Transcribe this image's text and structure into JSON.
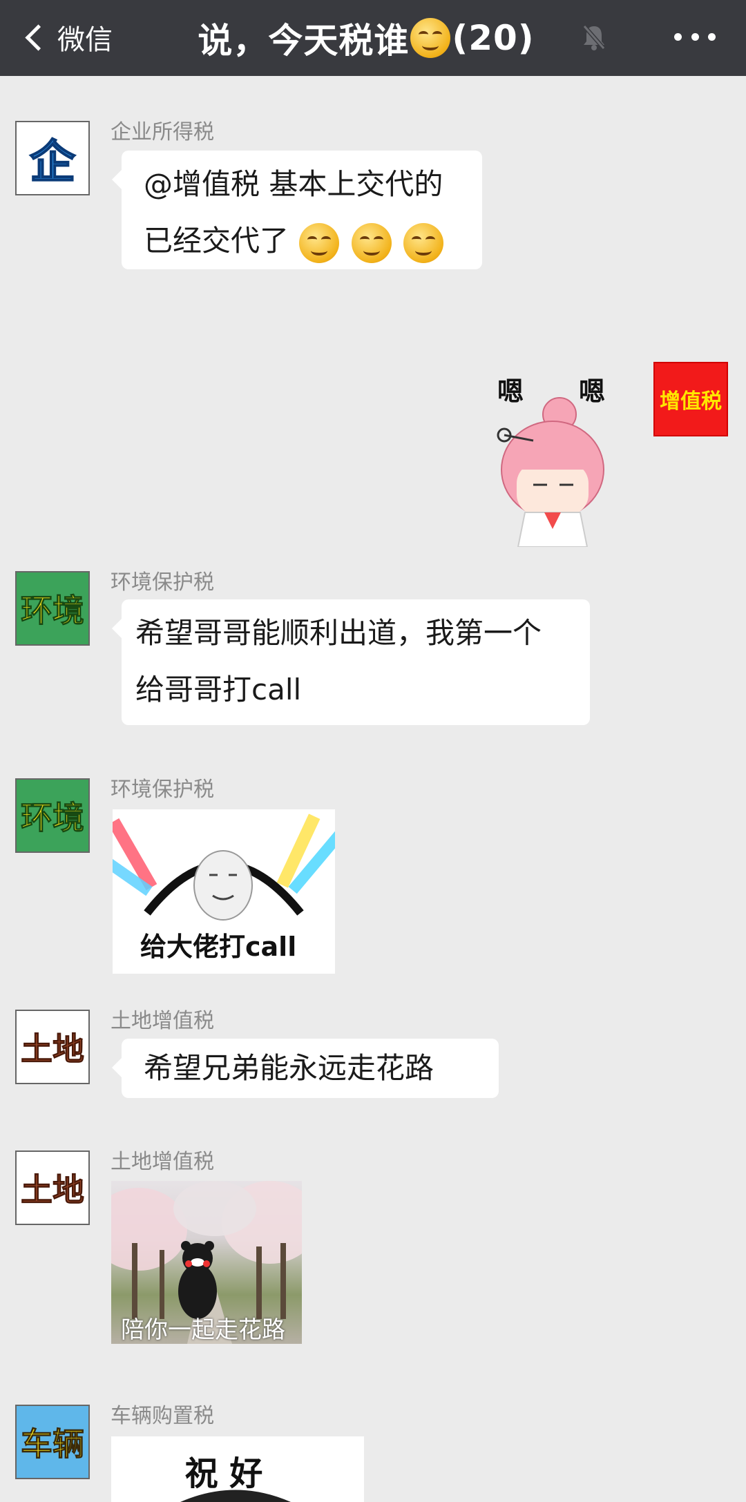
{
  "header": {
    "back_label": "微信",
    "title_pre": "说，今天税谁",
    "title_count": "(20)"
  },
  "messages": [
    {
      "sender": "企业所得税",
      "avatar_text": "企",
      "lines": [
        "@增值税 基本上交代的",
        "已经交代了"
      ]
    },
    {
      "self_avatar_text": "增值税",
      "sticker_text": "嗯 嗯"
    },
    {
      "sender": "环境保护税",
      "avatar_text": "环境",
      "lines": [
        "希望哥哥能顺利出道，我第一个",
        "给哥哥打call"
      ]
    },
    {
      "sender": "环境保护税",
      "avatar_text": "环境",
      "sticker_caption": "给大佬打call"
    },
    {
      "sender": "土地增值税",
      "avatar_text": "土地",
      "lines": [
        "希望兄弟能永远走花路"
      ]
    },
    {
      "sender": "土地增值税",
      "avatar_text": "土地",
      "sticker_caption": "陪你一起走花路"
    },
    {
      "sender": "车辆购置税",
      "avatar_text": "车辆",
      "sticker_caption": "祝 好"
    }
  ],
  "icons": [
    "chevron-left-icon",
    "mute-bell-icon",
    "more-dots-icon",
    "smirk-emoji-icon"
  ]
}
